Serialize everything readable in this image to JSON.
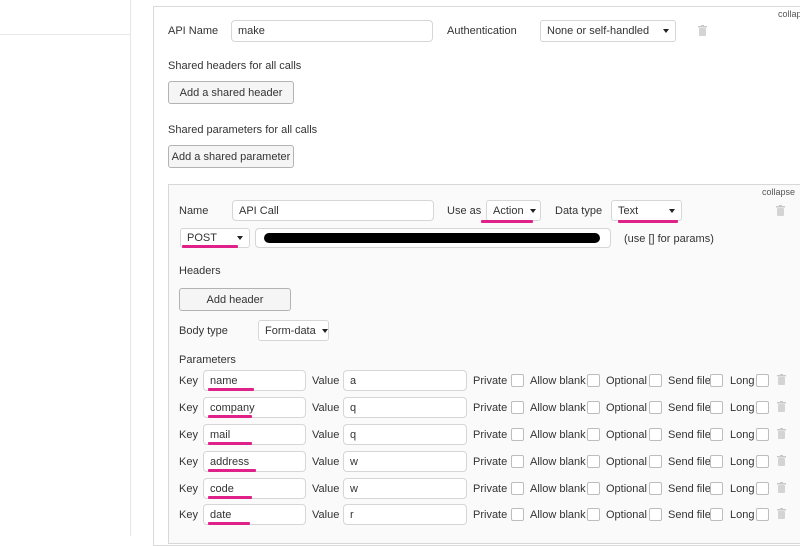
{
  "api": {
    "collapse_label": "collapse",
    "name_label": "API Name",
    "name_value": "make",
    "auth_label": "Authentication",
    "auth_value": "None or self-handled",
    "shared_headers_label": "Shared headers for all calls",
    "add_shared_header": "Add a shared header",
    "shared_params_label": "Shared parameters for all calls",
    "add_shared_param": "Add a shared parameter"
  },
  "call": {
    "collapse_label": "collapse",
    "name_label": "Name",
    "name_value": "API Call",
    "use_as_label": "Use as",
    "use_as_value": "Action",
    "data_type_label": "Data type",
    "data_type_value": "Text",
    "method_value": "POST",
    "url_hint": "(use [] for params)",
    "headers_label": "Headers",
    "add_header": "Add header",
    "body_type_label": "Body type",
    "body_type_value": "Form-data",
    "parameters_label": "Parameters",
    "key_label": "Key",
    "value_label": "Value",
    "private_label": "Private",
    "allow_blank_label": "Allow blank",
    "optional_label": "Optional",
    "send_file_label": "Send file",
    "long_label": "Long",
    "params": [
      {
        "key": "name",
        "value": "a"
      },
      {
        "key": "company",
        "value": "q"
      },
      {
        "key": "mail",
        "value": "q"
      },
      {
        "key": "address",
        "value": "w"
      },
      {
        "key": "code",
        "value": "w"
      },
      {
        "key": "date",
        "value": "r"
      }
    ]
  },
  "colors": {
    "highlight": "#e0218a",
    "border": "#d6d6d6"
  }
}
